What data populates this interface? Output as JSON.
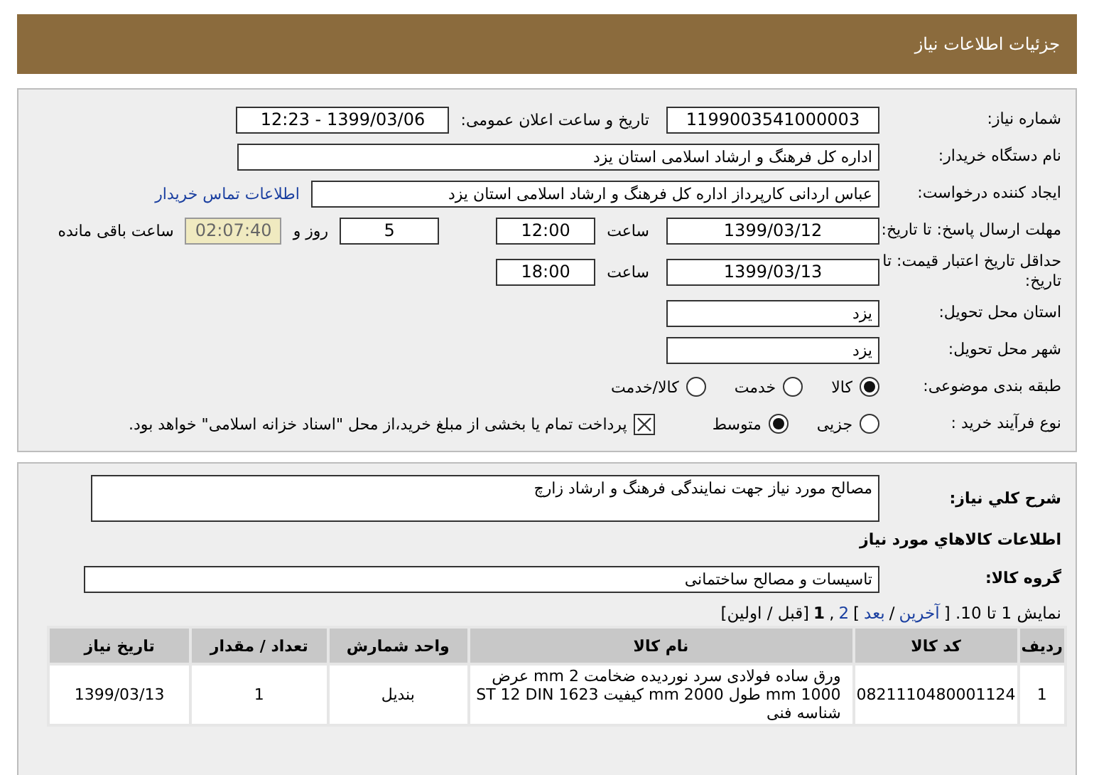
{
  "header": {
    "title": "جزئیات اطلاعات نیاز"
  },
  "need_number": {
    "label": "شماره نیاز:",
    "value": "1199003541000003"
  },
  "announce": {
    "label": "تاریخ و ساعت اعلان عمومی:",
    "value": "1399/03/06 - 12:23"
  },
  "buyer_org": {
    "label": "نام دستگاه خریدار:",
    "value": "اداره کل فرهنگ و ارشاد اسلامی استان یزد"
  },
  "requester": {
    "label": "ایجاد کننده درخواست:",
    "value": "عباس اردانی کارپرداز اداره کل فرهنگ و ارشاد اسلامی استان یزد",
    "link": "اطلاعات تماس خریدار"
  },
  "deadline": {
    "label": "مهلت ارسال پاسخ: تا تاریخ:",
    "date": "1399/03/12",
    "time_label": "ساعت",
    "time": "12:00",
    "days": "5",
    "days_label": "روز و",
    "remaining": "02:07:40",
    "remaining_label": "ساعت باقی مانده"
  },
  "validity": {
    "label": "حداقل تاریخ اعتبار قیمت: تا تاریخ:",
    "date": "1399/03/13",
    "time_label": "ساعت",
    "time": "18:00"
  },
  "province": {
    "label": "استان محل تحویل:",
    "value": "یزد"
  },
  "city": {
    "label": "شهر محل تحویل:",
    "value": "یزد"
  },
  "category": {
    "label": "طبقه بندی موضوعی:",
    "options": [
      {
        "label": "کالا",
        "selected": true
      },
      {
        "label": "خدمت",
        "selected": false
      },
      {
        "label": "کالا/خدمت",
        "selected": false
      }
    ]
  },
  "process": {
    "label": "نوع فرآیند خرید :",
    "options": [
      {
        "label": "جزیی",
        "selected": false
      },
      {
        "label": "متوسط",
        "selected": true
      }
    ],
    "treasury": {
      "checked": true,
      "label": "پرداخت تمام یا بخشی از مبلغ خرید،از محل \"اسناد خزانه اسلامی\" خواهد بود."
    }
  },
  "description": {
    "label": "شرح کلي نياز:",
    "value": "مصالح مورد نیاز جهت نمایندگی فرهنگ و ارشاد زارچ"
  },
  "goods_heading": "اطلاعات کالاهاي مورد نياز",
  "goods_group": {
    "label": "گروه کالا:",
    "value": "تاسیسات و مصالح ساختمانی"
  },
  "pagination": [
    {
      "kind": "plain",
      "text": "نمایش 1 تا 10. ["
    },
    {
      "kind": "link",
      "text": "آخرین"
    },
    {
      "kind": "plain",
      "text": "/"
    },
    {
      "kind": "link",
      "text": "بعد"
    },
    {
      "kind": "plain",
      "text": "]"
    },
    {
      "kind": "link",
      "text": "2"
    },
    {
      "kind": "plain",
      "text": ","
    },
    {
      "kind": "current",
      "text": "1"
    },
    {
      "kind": "plain",
      "text": "[قبل / اولین]"
    }
  ],
  "table": {
    "columns": [
      "ردیف",
      "کد کالا",
      "نام کالا",
      "واحد شمارش",
      "تعداد / مقدار",
      "تاریخ نیاز"
    ],
    "rows": [
      [
        "1",
        "0821110480001124",
        "ورق ساده فولادی سرد نوردیده ضخامت 2 mm عرض 1000 mm طول 2000 mm کیفیت ST 12 DIN 1623 شناسه فنی",
        "بندیل",
        "1",
        "1399/03/13"
      ]
    ]
  }
}
